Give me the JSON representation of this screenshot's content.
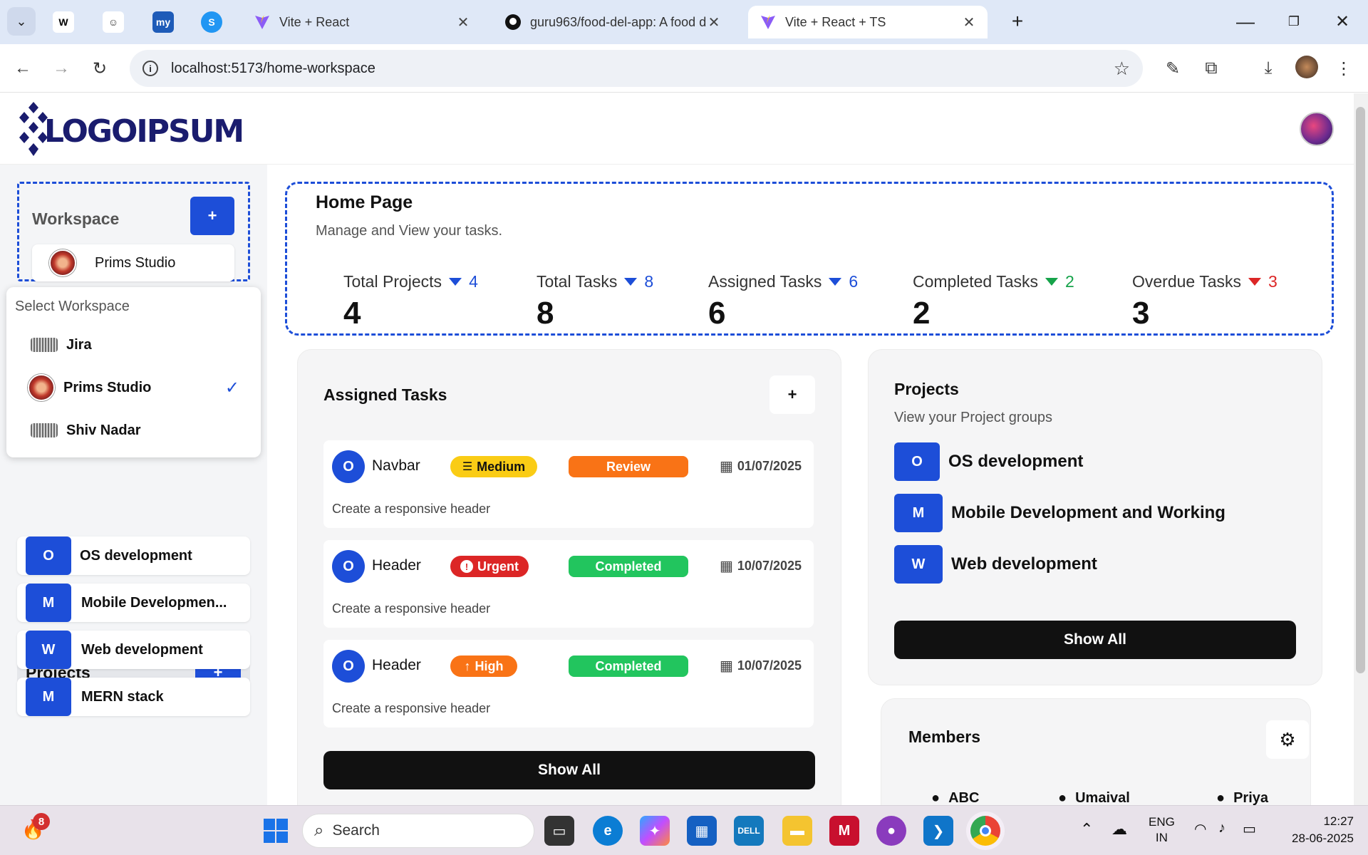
{
  "browser": {
    "tabs": [
      {
        "title": "Vite + React"
      },
      {
        "title": "guru963/food-del-app: A food d"
      },
      {
        "title": "Vite + React + TS"
      }
    ],
    "url": "localhost:5173/home-workspace"
  },
  "app": {
    "logo": "LOGOIPSUM"
  },
  "sidebar": {
    "workspace_title": "Workspace",
    "add_label": "+",
    "current_workspace": "Prims Studio",
    "dropdown_title": "Select Workspace",
    "workspaces": [
      {
        "name": "Jira",
        "selected": false
      },
      {
        "name": "Prims Studio",
        "selected": true
      },
      {
        "name": "Shiv Nadar",
        "selected": false
      }
    ],
    "projects_title": "Projects",
    "projects": [
      {
        "initial": "O",
        "name": "OS development"
      },
      {
        "initial": "M",
        "name": "Mobile Developmen..."
      },
      {
        "initial": "W",
        "name": "Web development"
      },
      {
        "initial": "M",
        "name": "MERN stack"
      }
    ]
  },
  "home": {
    "title": "Home Page",
    "subtitle": "Manage and View your tasks.",
    "stats": [
      {
        "label": "Total Projects",
        "delta": "4",
        "value": "4",
        "trend_color": "#1d4ed8"
      },
      {
        "label": "Total Tasks",
        "delta": "8",
        "value": "8",
        "trend_color": "#1d4ed8"
      },
      {
        "label": "Assigned Tasks",
        "delta": "6",
        "value": "6",
        "trend_color": "#1d4ed8"
      },
      {
        "label": "Completed Tasks",
        "delta": "2",
        "value": "2",
        "trend_color": "#16a34a"
      },
      {
        "label": "Overdue Tasks",
        "delta": "3",
        "value": "3",
        "trend_color": "#dc2626"
      }
    ]
  },
  "assigned_tasks": {
    "title": "Assigned Tasks",
    "add_label": "+",
    "tasks": [
      {
        "initial": "O",
        "name": "Navbar",
        "priority": "Medium",
        "status": "Review",
        "date": "01/07/2025",
        "description": "Create a responsive header"
      },
      {
        "initial": "O",
        "name": "Header",
        "priority": "Urgent",
        "status": "Completed",
        "date": "10/07/2025",
        "description": "Create a responsive header"
      },
      {
        "initial": "O",
        "name": "Header",
        "priority": "High",
        "status": "Completed",
        "date": "10/07/2025",
        "description": "Create a responsive header"
      }
    ],
    "show_all": "Show All"
  },
  "projects_panel": {
    "title": "Projects",
    "subtitle": "View your Project groups",
    "projects": [
      {
        "initial": "O",
        "name": "OS development"
      },
      {
        "initial": "M",
        "name": "Mobile Development and Working"
      },
      {
        "initial": "W",
        "name": "Web development"
      }
    ],
    "show_all": "Show All"
  },
  "members_panel": {
    "title": "Members",
    "members": [
      "ABC",
      "Umaival",
      "Priya"
    ]
  },
  "taskbar": {
    "search_placeholder": "Search",
    "notification_count": "8",
    "lang_line1": "ENG",
    "lang_line2": "IN",
    "time": "12:27",
    "date": "28-06-2025"
  },
  "colors": {
    "accent": "#1d4ed8",
    "medium": "#facc15",
    "urgent": "#dc2626",
    "high": "#f97316",
    "review": "#f97316",
    "completed": "#22c55e"
  }
}
